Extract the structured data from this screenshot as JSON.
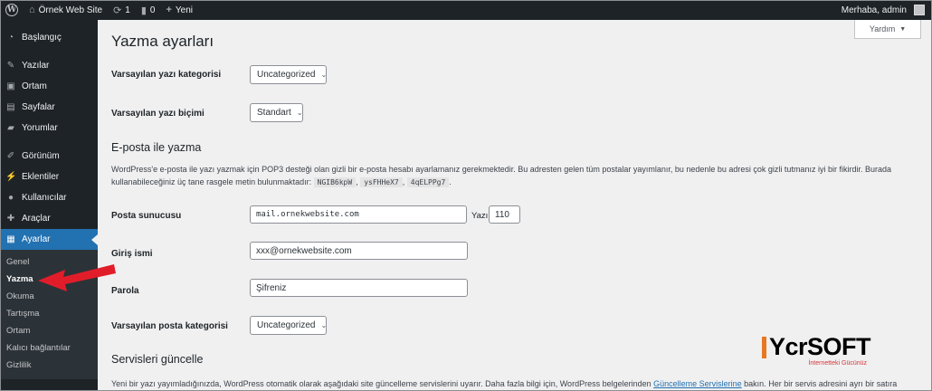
{
  "adminbar": {
    "site_name": "Örnek Web Site",
    "updates_count": "1",
    "comments_count": "0",
    "new_label": "Yeni",
    "greeting": "Merhaba, admin"
  },
  "sidebar": {
    "items": [
      {
        "label": "Başlangıç",
        "icon": "dashboard-icon"
      },
      {
        "label": "Yazılar",
        "icon": "pin-icon"
      },
      {
        "label": "Ortam",
        "icon": "media-icon"
      },
      {
        "label": "Sayfalar",
        "icon": "page-icon"
      },
      {
        "label": "Yorumlar",
        "icon": "comment-icon"
      },
      {
        "label": "Görünüm",
        "icon": "brush-icon"
      },
      {
        "label": "Eklentiler",
        "icon": "plugin-icon"
      },
      {
        "label": "Kullanıcılar",
        "icon": "users-icon"
      },
      {
        "label": "Araçlar",
        "icon": "wrench-icon"
      },
      {
        "label": "Ayarlar",
        "icon": "settings-icon"
      }
    ],
    "submenu": [
      "Genel",
      "Yazma",
      "Okuma",
      "Tartışma",
      "Ortam",
      "Kalıcı bağlantılar",
      "Gizlilik"
    ]
  },
  "help": {
    "label": "Yardım"
  },
  "page": {
    "title": "Yazma ayarları",
    "default_category_label": "Varsayılan yazı kategorisi",
    "default_category_value": "Uncategorized",
    "default_format_label": "Varsayılan yazı biçimi",
    "default_format_value": "Standart",
    "email_heading": "E-posta ile yazma",
    "email_desc_1": "WordPress'e e-posta ile yazı yazmak için POP3 desteği olan gizli bir e-posta hesabı ayarlamanız gerekmektedir. Bu adresten gelen tüm postalar yayımlanır, bu nedenle bu adresi çok gizli tutmanız iyi bir fikirdir. Burada kullanabileceğiniz üç tane rasgele metin bulunmaktadır:",
    "codes": [
      "NGIB6kpW",
      "ysFHHeX7",
      "4qELPPg7"
    ],
    "mail_server_label": "Posta sunucusu",
    "mail_server_value": "mail.ornekwebsite.com",
    "port_label": "Yazı",
    "port_value": "110",
    "login_label": "Giriş ismi",
    "login_value": "xxx@ornekwebsite.com",
    "password_label": "Parola",
    "password_value": "Şifreniz",
    "mail_category_label": "Varsayılan posta kategorisi",
    "mail_category_value": "Uncategorized",
    "services_heading": "Servisleri güncelle",
    "services_desc_before": "Yeni bir yazı yayımladığınızda, WordPress otomatik olarak aşağıdaki site güncelleme servislerini uyarır. Daha fazla bilgi için, WordPress belgelerinden ",
    "services_link": "Güncelleme Servislerine",
    "services_desc_after": " bakın. Her bir servis adresini ayrı bir satıra yazın."
  },
  "watermark": {
    "brand": "YcrSOFT",
    "tagline": "İnternetteki Gücünüz"
  },
  "colors": {
    "adminbar_bg": "#1d2327",
    "active_menu": "#2271b1",
    "arrow": "#e11d2a",
    "brand_orange": "#e87722"
  }
}
